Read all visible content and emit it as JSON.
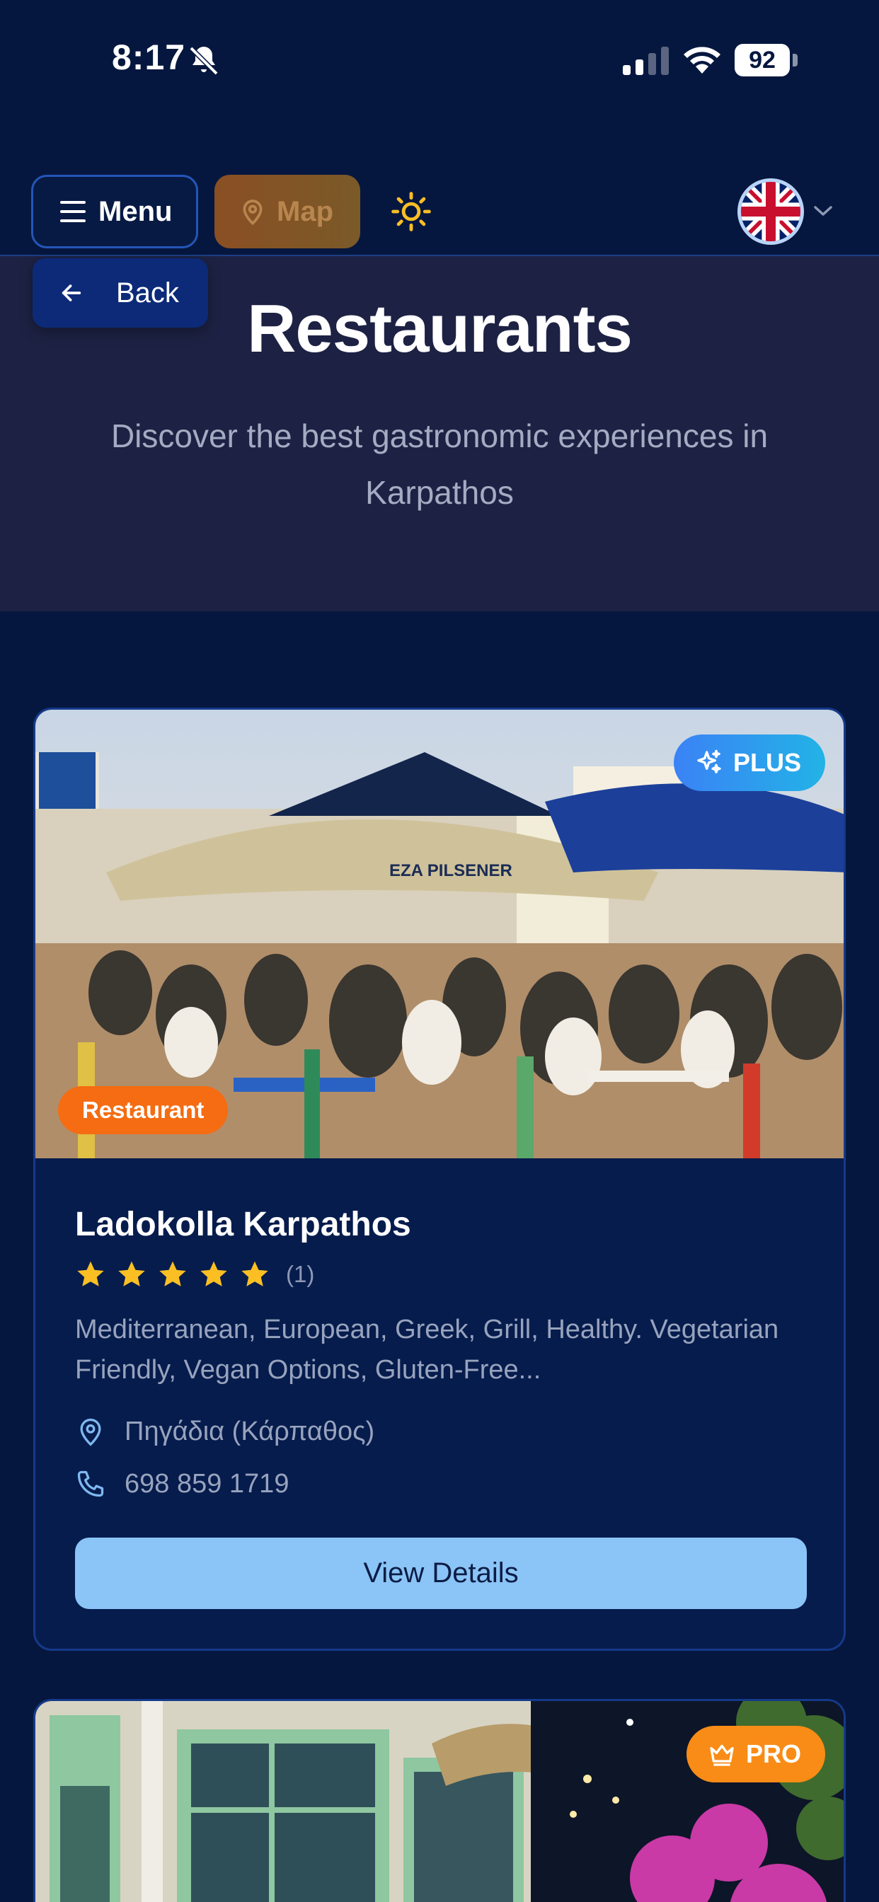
{
  "status_bar": {
    "time": "8:17",
    "battery": "92"
  },
  "nav": {
    "menu_label": "Menu",
    "map_label": "Map",
    "language": "English"
  },
  "hero": {
    "back_label": "Back",
    "title": "Restaurants",
    "subtitle": "Discover the best gastronomic experiences in Karpathos"
  },
  "listings": [
    {
      "tier": "PLUS",
      "category": "Restaurant",
      "name": "Ladokolla Karpathos",
      "rating": 5,
      "review_count": "(1)",
      "cuisines": "Mediterranean, European, Greek, Grill, Healthy. Vegetarian Friendly, Vegan Options, Gluten-Free...",
      "location": "Πηγάδια (Κάρπαθος)",
      "phone": "698 859 1719",
      "details_label": "View Details"
    },
    {
      "tier": "PRO"
    }
  ],
  "colors": {
    "background": "#06173f",
    "hero": "#1d2244",
    "accent_blue": "#8bc4f7",
    "category_orange": "#f56c12",
    "pro_orange": "#f98c16",
    "star": "#fbbf24"
  }
}
